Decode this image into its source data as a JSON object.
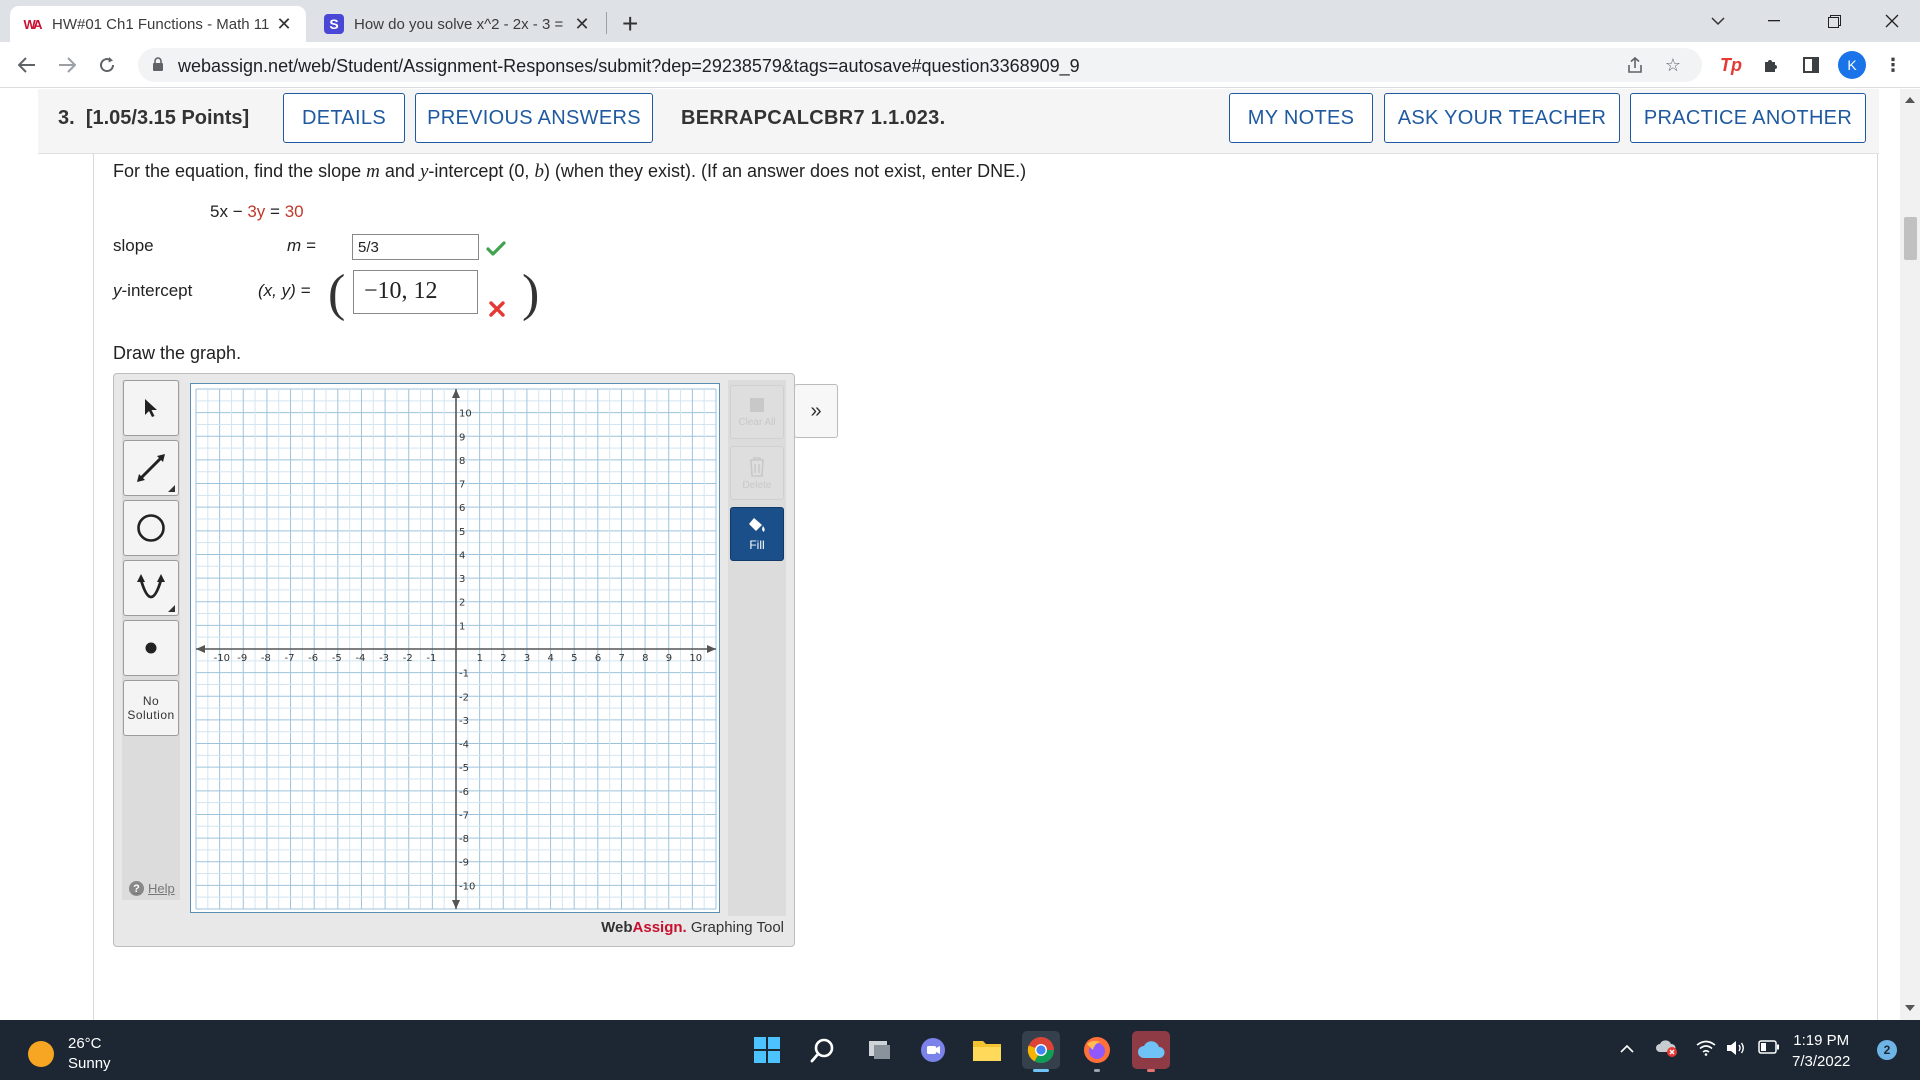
{
  "browser": {
    "tabs": [
      {
        "title": "HW#01 Ch1 Functions - Math 11",
        "favicon": "webassign-icon",
        "active": true
      },
      {
        "title": "How do you solve x^2 - 2x - 3 =",
        "favicon": "socratic-icon",
        "active": false
      }
    ],
    "url": "webassign.net/web/Student/Assignment-Responses/submit?dep=29238579&tags=autosave#question3368909_9",
    "profile_initial": "K",
    "ext_tp": "Tp"
  },
  "question": {
    "number": "3.",
    "points": "[1.05/3.15 Points]",
    "buttons": {
      "details": "DETAILS",
      "previous": "PREVIOUS ANSWERS",
      "my_notes": "MY NOTES",
      "ask_teacher": "ASK YOUR TEACHER",
      "practice": "PRACTICE ANOTHER"
    },
    "code": "BERRAPCALCBR7 1.1.023.",
    "instruction": {
      "p1": "For the equation, find the slope ",
      "m": "m",
      "p2": " and ",
      "y": "y",
      "p3": "-intercept (0, ",
      "b": "b",
      "p4": ") (when they exist). (If an answer does not exist, enter DNE.)"
    },
    "equation": {
      "a": "5x",
      "minus": " − ",
      "b": "3y",
      "eq": " = ",
      "c": "30"
    },
    "slope_label": "slope",
    "slope_var": "m  =",
    "slope_answer": "5/3",
    "slope_status": "correct",
    "yint_label_var": "y",
    "yint_label_rest": "-intercept",
    "yint_var": "(x, y)  =",
    "yint_answer": "−10, 12",
    "yint_status": "incorrect",
    "draw_label": "Draw the graph."
  },
  "graph_tool": {
    "tools": [
      "select-arrow-icon",
      "line-tool-icon",
      "circle-tool-icon",
      "parabola-tool-icon",
      "point-tool-icon"
    ],
    "no_solution_line1": "No",
    "no_solution_line2": "Solution",
    "help": "Help",
    "clear_all": "Clear All",
    "delete": "Delete",
    "fill": "Fill",
    "brand_web": "Web",
    "brand_assign": "Assign.",
    "brand_rest": " Graphing Tool",
    "expand": "»",
    "xlim": [
      -10,
      10
    ],
    "ylim": [
      -10,
      10
    ],
    "grid": true
  },
  "taskbar": {
    "temp": "26°C",
    "condition": "Sunny",
    "time": "1:19 PM",
    "date": "7/3/2022",
    "notifications": "2"
  }
}
